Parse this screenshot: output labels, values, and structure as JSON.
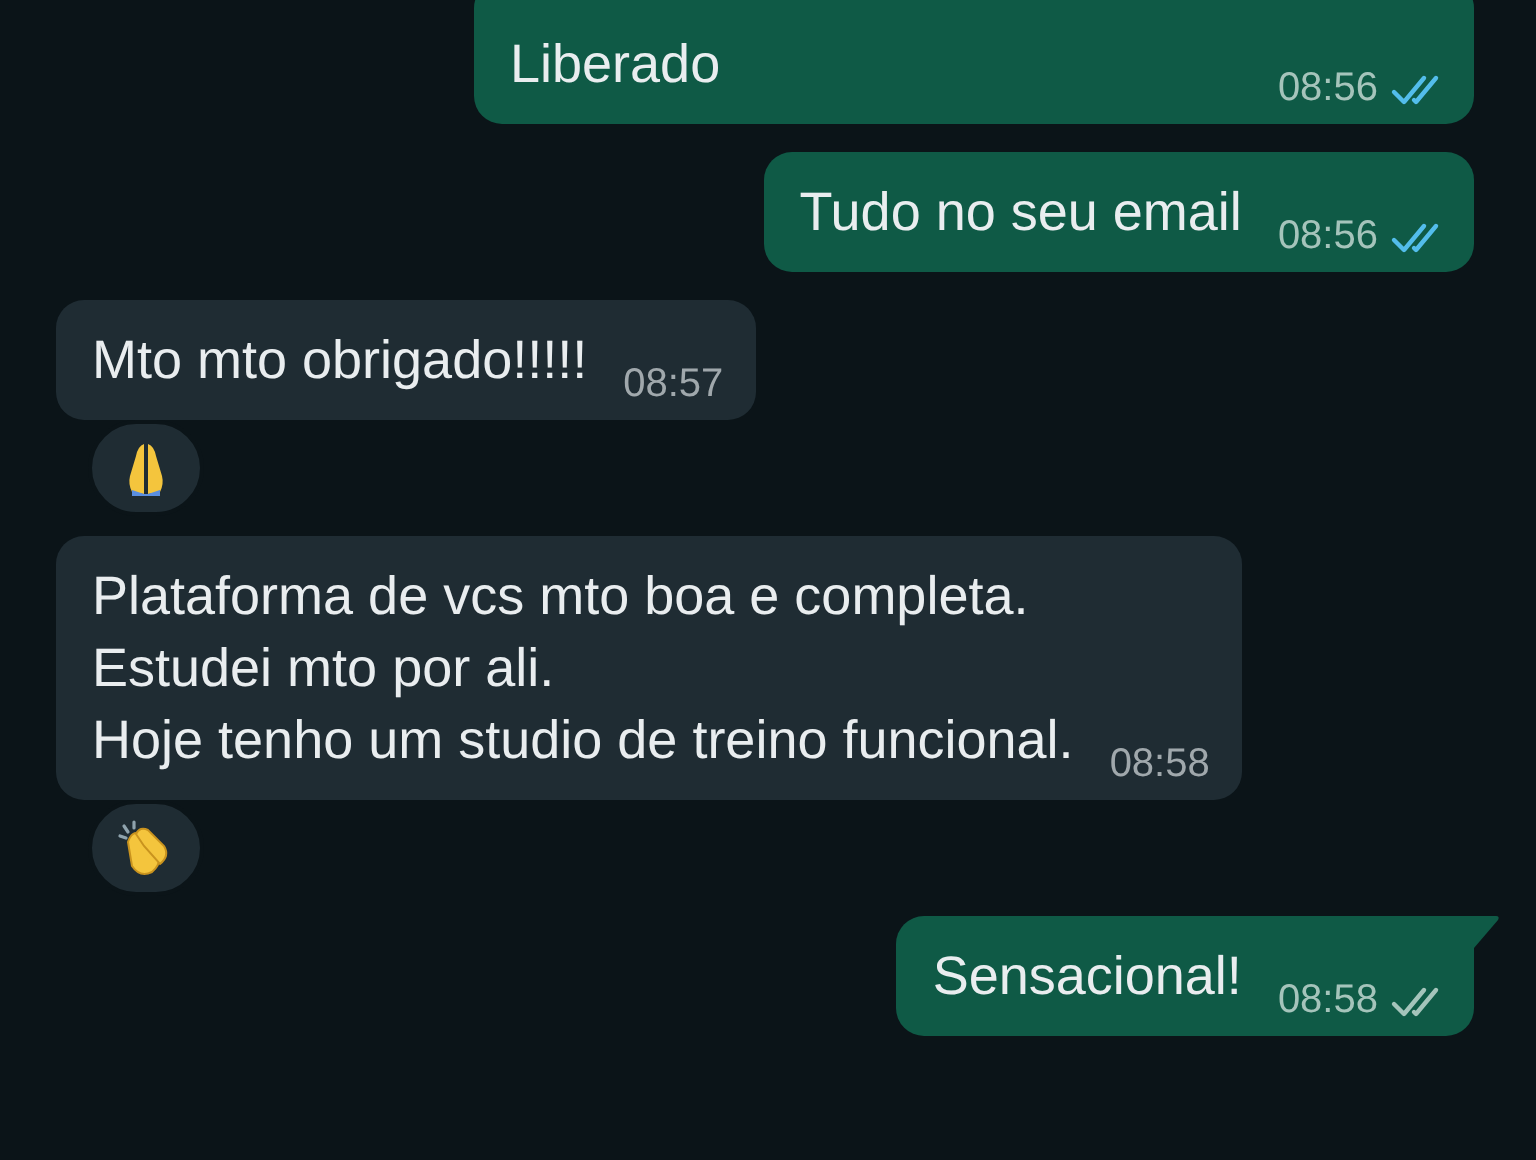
{
  "messages": [
    {
      "outgoing": true,
      "text": "Liberado",
      "time": "08:56",
      "read": true,
      "tail": false
    },
    {
      "outgoing": true,
      "text": "Tudo no seu email",
      "time": "08:56",
      "read": true,
      "tail": false
    },
    {
      "outgoing": false,
      "text": "Mto mto obrigado!!!!!",
      "time": "08:57",
      "reaction": {
        "kind": "pray"
      },
      "tail": false
    },
    {
      "outgoing": false,
      "text": "Plataforma de vcs mto boa e completa.\nEstudei mto por ali.\nHoje tenho um studio de treino funcional.",
      "time": "08:58",
      "reaction": {
        "kind": "clap"
      },
      "tail": false
    },
    {
      "outgoing": true,
      "text": "Sensacional!",
      "time": "08:58",
      "read": false,
      "tail": true
    }
  ]
}
